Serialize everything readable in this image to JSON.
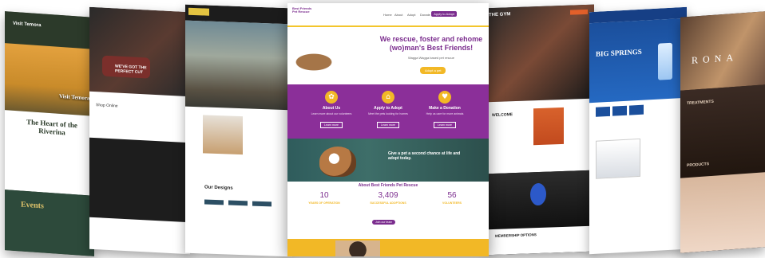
{
  "main": {
    "logo": "Best Friends Pet Rescue",
    "nav": [
      "Home",
      "About",
      "Adopt",
      "Donate",
      "Contact"
    ],
    "cta": "Apply to Adopt",
    "headline": "We rescue, foster and rehome (wo)man's Best Friends!",
    "subheadline": "Wagga Wagga based pet rescue",
    "hero_button": "Adopt a pet",
    "columns": [
      {
        "icon": "✿",
        "title": "About Us",
        "desc": "Learn more about our volunteers",
        "btn": "Learn more"
      },
      {
        "icon": "⌂",
        "title": "Apply to Adopt",
        "desc": "Meet the pets looking for homes",
        "btn": "Learn more"
      },
      {
        "icon": "♥",
        "title": "Make a Donation",
        "desc": "Help us care for more animals",
        "btn": "Learn more"
      }
    ],
    "dog_text": "Give a pet a second chance at life and adopt today.",
    "about_heading": "About Best Friends Pet Rescue",
    "stats": [
      {
        "value": "10",
        "label": "YEARS OF OPERATION"
      },
      {
        "value": "3,409",
        "label": "SUCCESSFUL ADOPTIONS"
      },
      {
        "value": "56",
        "label": "VOLUNTEERS"
      }
    ],
    "stats_button": "Join our team"
  },
  "left1": {
    "logo": "Visit Temora",
    "brand": "Visit Temora",
    "heading": "The Heart of the Riverina",
    "events": "Events"
  },
  "left2": {
    "hero_text": "WE'VE GOT THE PERFECT CUT",
    "section": "Shop Online"
  },
  "left3": {
    "badge": "",
    "heading": "Our Designs"
  },
  "right1": {
    "logo": "THE GYM",
    "welcome": "WELCOME",
    "workouts": "MEMBERSHIP OPTIONS"
  },
  "right2": {
    "name": "BIG SPRINGS"
  },
  "right3": {
    "brand": "RONA",
    "label1": "TREATMENTS",
    "label2": "PRODUCTS"
  }
}
